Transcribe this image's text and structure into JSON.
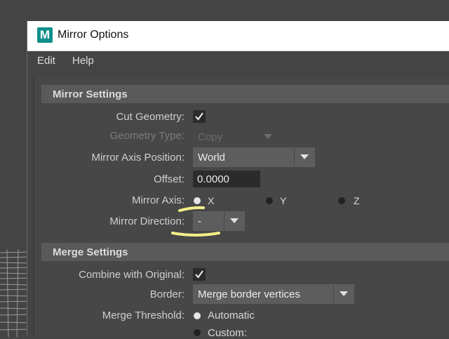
{
  "window": {
    "title": "Mirror Options",
    "logo_letter": "M"
  },
  "menu": {
    "items": [
      {
        "label": "Edit"
      },
      {
        "label": "Help"
      }
    ]
  },
  "mirror_settings": {
    "header": "Mirror Settings",
    "cut_geometry_label": "Cut Geometry:",
    "cut_geometry_checked": true,
    "geometry_type_label": "Geometry Type:",
    "geometry_type_value": "Copy",
    "mirror_axis_position_label": "Mirror Axis Position:",
    "mirror_axis_position_value": "World",
    "offset_label": "Offset:",
    "offset_value": "0.0000",
    "mirror_axis_label": "Mirror Axis:",
    "mirror_axis_options": [
      {
        "label": "X",
        "selected": true
      },
      {
        "label": "Y",
        "selected": false
      },
      {
        "label": "Z",
        "selected": false
      }
    ],
    "mirror_direction_label": "Mirror Direction:",
    "mirror_direction_value": "-"
  },
  "merge_settings": {
    "header": "Merge Settings",
    "combine_label": "Combine with Original:",
    "combine_checked": true,
    "border_label": "Border:",
    "border_value": "Merge border vertices",
    "merge_threshold_label": "Merge Threshold:",
    "merge_threshold_options": [
      {
        "label": "Automatic",
        "selected": true
      },
      {
        "label": "Custom:",
        "selected": false
      }
    ]
  },
  "colors": {
    "highlight": "#f3f08a",
    "accent_logo": "#0e8f8d"
  }
}
